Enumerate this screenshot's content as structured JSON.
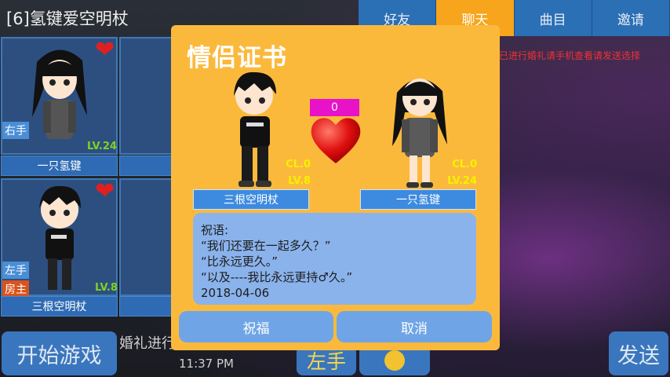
{
  "room": {
    "title": "[6]氢键爱空明杖"
  },
  "tabs": [
    {
      "label": "好友"
    },
    {
      "label": "聊天"
    },
    {
      "label": "曲目"
    },
    {
      "label": "邀请"
    }
  ],
  "chat": {
    "line": "已进行婚礼请手机查看请发送选择"
  },
  "players": [
    {
      "name": "一只氢键",
      "hand": "右手",
      "level": "LV.24",
      "host": ""
    },
    {
      "name": "三根空明杖",
      "hand": "左手",
      "level": "LV.8",
      "host": "房主"
    }
  ],
  "bottom": {
    "start_label": "开始游戏",
    "wedding_text": "婚礼进行",
    "time": "11:37 PM",
    "hand_label": "左手",
    "send_label": "发送"
  },
  "dialog": {
    "title": "情侣证书",
    "counter": "0",
    "left": {
      "name": "三根空明杖",
      "cl": "CL.0",
      "lv": "LV.8"
    },
    "right": {
      "name": "一只氢键",
      "cl": "CL.0",
      "lv": "LV.24"
    },
    "blessing_lines": [
      "祝语:",
      "“我们还要在一起多久？”",
      "“比永远更久。”",
      "“以及----我比永远更持♂久。”",
      "2018-04-06"
    ],
    "bless_button": "祝福",
    "cancel_button": "取消"
  },
  "colors": {
    "dialog_bg": "#fbb93c",
    "tab_active": "#f7a51c",
    "tab_normal": "#2b6fb5",
    "counter_bg": "#e812c9"
  }
}
